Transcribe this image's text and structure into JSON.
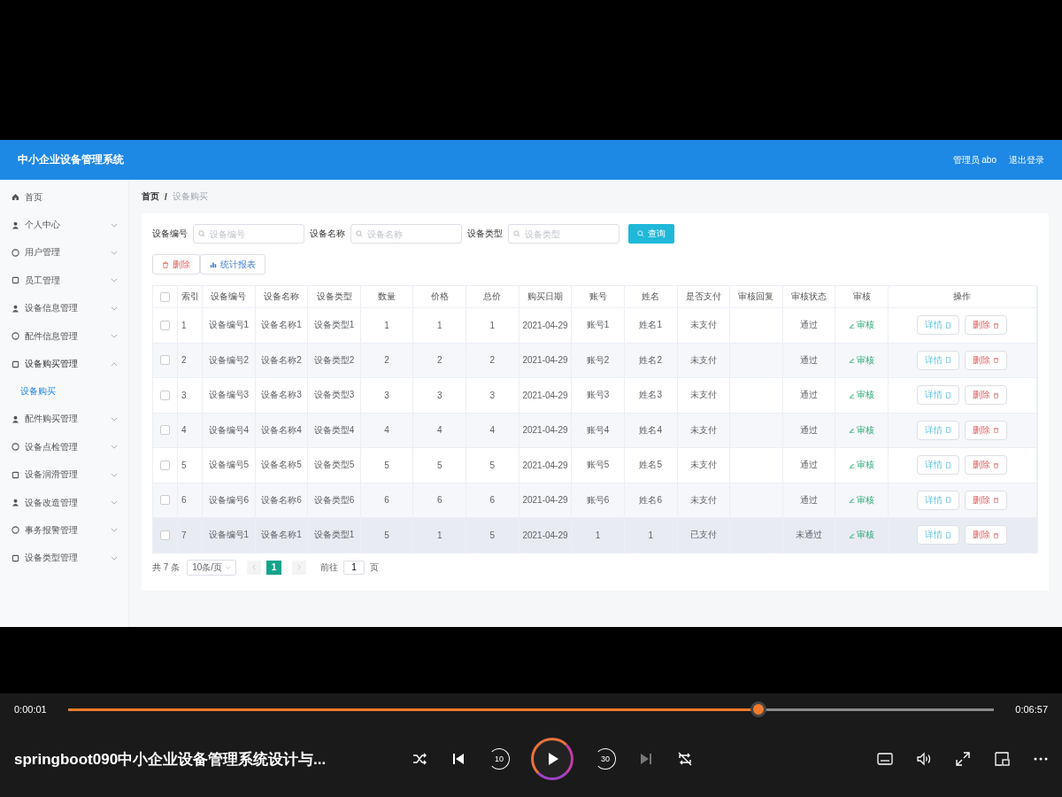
{
  "app": {
    "title": "中小企业设备管理系统",
    "user": "管理员 abo",
    "logout": "退出登录"
  },
  "sidebar": {
    "items": [
      {
        "label": "首页",
        "kind": "link"
      },
      {
        "label": "个人中心",
        "kind": "menu",
        "expanded": false
      },
      {
        "label": "用户管理",
        "kind": "menu",
        "expanded": false
      },
      {
        "label": "员工管理",
        "kind": "menu",
        "expanded": false
      },
      {
        "label": "设备信息管理",
        "kind": "menu",
        "expanded": false
      },
      {
        "label": "配件信息管理",
        "kind": "menu",
        "expanded": false
      },
      {
        "label": "设备购买管理",
        "kind": "menu",
        "expanded": true,
        "children": [
          {
            "label": "设备购买",
            "selected": true
          }
        ]
      },
      {
        "label": "配件购买管理",
        "kind": "menu",
        "expanded": false
      },
      {
        "label": "设备点检管理",
        "kind": "menu",
        "expanded": false
      },
      {
        "label": "设备润滑管理",
        "kind": "menu",
        "expanded": false
      },
      {
        "label": "设备改造管理",
        "kind": "menu",
        "expanded": false
      },
      {
        "label": "事务报警管理",
        "kind": "menu",
        "expanded": false
      },
      {
        "label": "设备类型管理",
        "kind": "menu",
        "expanded": false
      }
    ]
  },
  "breadcrumb": {
    "items": [
      "首页",
      "设备购买"
    ],
    "separator": "/"
  },
  "search": {
    "fields": [
      {
        "label": "设备编号",
        "placeholder": "设备编号"
      },
      {
        "label": "设备名称",
        "placeholder": "设备名称"
      },
      {
        "label": "设备类型",
        "placeholder": "设备类型"
      }
    ],
    "button": "查询"
  },
  "toolbar": {
    "delete": "删除",
    "report": "统计报表"
  },
  "table": {
    "all_checked": false,
    "columns": [
      "索引",
      "设备编号",
      "设备名称",
      "设备类型",
      "数量",
      "价格",
      "总价",
      "购买日期",
      "账号",
      "姓名",
      "是否支付",
      "审核回复",
      "审核状态",
      "审核",
      "操作"
    ],
    "rows": [
      {
        "checked": false,
        "hovered": false,
        "cells": [
          "1",
          "设备编号1",
          "设备名称1",
          "设备类型1",
          "1",
          "1",
          "1",
          "2021-04-29",
          "账号1",
          "姓名1",
          "未支付"
        ],
        "status": "通过",
        "review": "审核",
        "actions": [
          "详情",
          "删除"
        ]
      },
      {
        "checked": false,
        "hovered": false,
        "cells": [
          "2",
          "设备编号2",
          "设备名称2",
          "设备类型2",
          "2",
          "2",
          "2",
          "2021-04-29",
          "账号2",
          "姓名2",
          "未支付"
        ],
        "status": "通过",
        "review": "审核",
        "actions": [
          "详情",
          "删除"
        ]
      },
      {
        "checked": false,
        "hovered": false,
        "cells": [
          "3",
          "设备编号3",
          "设备名称3",
          "设备类型3",
          "3",
          "3",
          "3",
          "2021-04-29",
          "账号3",
          "姓名3",
          "未支付"
        ],
        "status": "通过",
        "review": "审核",
        "actions": [
          "详情",
          "删除"
        ]
      },
      {
        "checked": false,
        "hovered": false,
        "cells": [
          "4",
          "设备编号4",
          "设备名称4",
          "设备类型4",
          "4",
          "4",
          "4",
          "2021-04-29",
          "账号4",
          "姓名4",
          "未支付"
        ],
        "status": "通过",
        "review": "审核",
        "actions": [
          "详情",
          "删除"
        ]
      },
      {
        "checked": false,
        "hovered": false,
        "cells": [
          "5",
          "设备编号5",
          "设备名称5",
          "设备类型5",
          "5",
          "5",
          "5",
          "2021-04-29",
          "账号5",
          "姓名5",
          "未支付"
        ],
        "status": "通过",
        "review": "审核",
        "actions": [
          "详情",
          "删除"
        ]
      },
      {
        "checked": false,
        "hovered": false,
        "cells": [
          "6",
          "设备编号6",
          "设备名称6",
          "设备类型6",
          "6",
          "6",
          "6",
          "2021-04-29",
          "账号6",
          "姓名6",
          "未支付"
        ],
        "status": "通过",
        "review": "审核",
        "actions": [
          "详情",
          "删除"
        ]
      },
      {
        "checked": false,
        "hovered": true,
        "cells": [
          "7",
          "设备编号1",
          "设备名称1",
          "设备类型1",
          "5",
          "1",
          "5",
          "2021-04-29",
          "1",
          "1",
          "已支付"
        ],
        "status": "未通过",
        "review": "审核",
        "actions": [
          "详情",
          "删除"
        ]
      }
    ]
  },
  "pagination": {
    "total": "共 7 条",
    "page_size": "10条/页",
    "pages": [
      {
        "label": "1",
        "selected": true
      }
    ],
    "goto": "前往",
    "goto_value": "1",
    "goto_suffix": "页"
  },
  "player": {
    "elapsed": "0:00:01",
    "duration": "0:06:57",
    "level": 0.746,
    "title": "springboot090中小企业设备管理系统设计与...",
    "rewind": "10",
    "forward": "30",
    "next_disabled": true
  }
}
